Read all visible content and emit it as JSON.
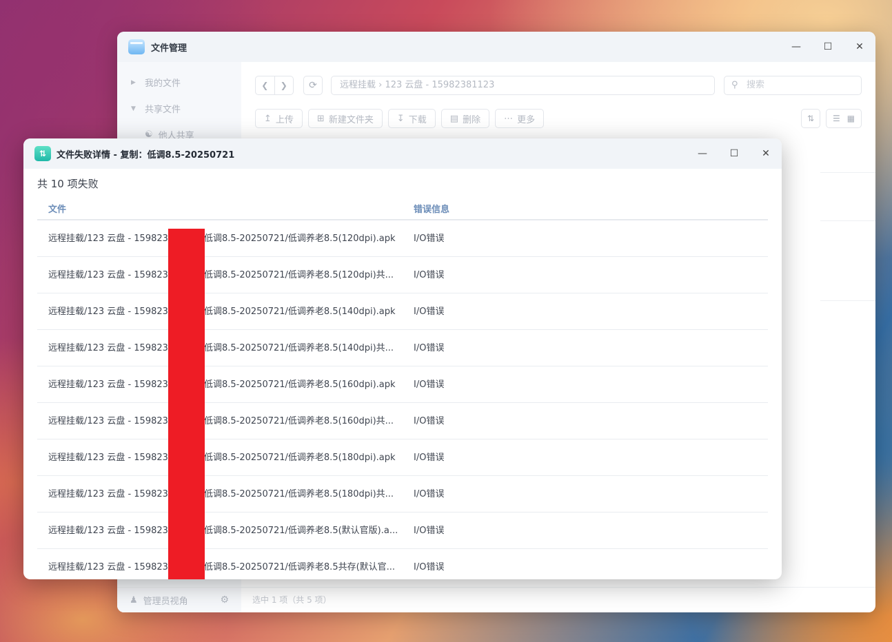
{
  "file_manager": {
    "title": "文件管理",
    "sidebar": {
      "my_files": "我的文件",
      "shared_files": "共享文件",
      "others_shared": "他人共享",
      "admin_view": "管理员视角"
    },
    "path": "远程挂载 › 123 云盘 - 15982381123",
    "search_placeholder": "搜索",
    "toolbar": {
      "upload": "上传",
      "new_folder": "新建文件夹",
      "download": "下载",
      "delete": "删除",
      "more": "更多"
    },
    "status": "选中 1 项（共 5 项）"
  },
  "dialog": {
    "title": "文件失败详情 - 复制：低调8.5-20250721",
    "summary": "共 10 项失败",
    "columns": {
      "file": "文件",
      "error": "错误信息"
    },
    "rows": [
      {
        "prefix": "远程挂载/123 云盘 - 159823",
        "suffix": "低调8.5-20250721/低调养老8.5(120dpi).apk",
        "error": "I/O错误"
      },
      {
        "prefix": "远程挂载/123 云盘 - 159823",
        "suffix": "低调8.5-20250721/低调养老8.5(120dpi)共...",
        "error": "I/O错误"
      },
      {
        "prefix": "远程挂载/123 云盘 - 159823",
        "suffix": "低调8.5-20250721/低调养老8.5(140dpi).apk",
        "error": "I/O错误"
      },
      {
        "prefix": "远程挂载/123 云盘 - 159823",
        "suffix": "低调8.5-20250721/低调养老8.5(140dpi)共...",
        "error": "I/O错误"
      },
      {
        "prefix": "远程挂载/123 云盘 - 159823",
        "suffix": "低调8.5-20250721/低调养老8.5(160dpi).apk",
        "error": "I/O错误"
      },
      {
        "prefix": "远程挂载/123 云盘 - 159823",
        "suffix": "低调8.5-20250721/低调养老8.5(160dpi)共...",
        "error": "I/O错误"
      },
      {
        "prefix": "远程挂载/123 云盘 - 159823",
        "suffix": "低调8.5-20250721/低调养老8.5(180dpi).apk",
        "error": "I/O错误"
      },
      {
        "prefix": "远程挂载/123 云盘 - 159823",
        "suffix": "低调8.5-20250721/低调养老8.5(180dpi)共...",
        "error": "I/O错误"
      },
      {
        "prefix": "远程挂载/123 云盘 - 159823",
        "suffix": "低调8.5-20250721/低调养老8.5(默认官版).a...",
        "error": "I/O错误"
      },
      {
        "prefix": "远程挂载/123 云盘 - 159823",
        "suffix": "低调8.5-20250721/低调养老8.5共存(默认官...",
        "error": "I/O错误"
      }
    ]
  }
}
